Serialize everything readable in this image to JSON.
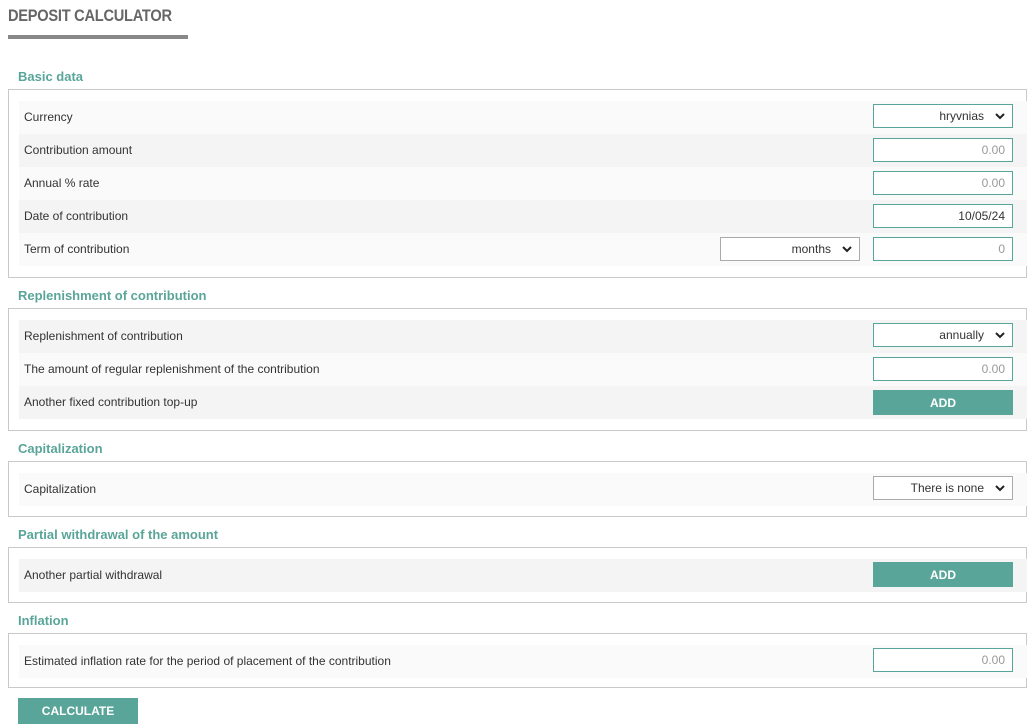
{
  "page": {
    "title": "DEPOSIT CALCULATOR"
  },
  "basic": {
    "title": "Basic data",
    "currency_label": "Currency",
    "currency_value": "hryvnias",
    "amount_label": "Contribution amount",
    "amount_placeholder": "0.00",
    "rate_label": "Annual % rate",
    "rate_placeholder": "0.00",
    "date_label": "Date of contribution",
    "date_value": "10/05/24",
    "term_label": "Term of contribution",
    "term_unit": "months",
    "term_placeholder": "0"
  },
  "replenishment": {
    "title": "Replenishment of contribution",
    "frequency_label": "Replenishment of contribution",
    "frequency_value": "annually",
    "amount_label": "The amount of regular replenishment of the contribution",
    "amount_placeholder": "0.00",
    "topup_label": "Another fixed contribution top-up",
    "add_label": "ADD"
  },
  "capitalization": {
    "title": "Capitalization",
    "label": "Capitalization",
    "value": "There is none"
  },
  "withdrawal": {
    "title": "Partial withdrawal of the amount",
    "label": "Another partial withdrawal",
    "add_label": "ADD"
  },
  "inflation": {
    "title": "Inflation",
    "label": "Estimated inflation rate for the period of placement of the contribution",
    "placeholder": "0.00"
  },
  "actions": {
    "calculate_label": "CALCULATE"
  },
  "colors": {
    "accent": "#5aa599",
    "title_bar": "#888888",
    "row_alt": "#f4f4f4"
  }
}
